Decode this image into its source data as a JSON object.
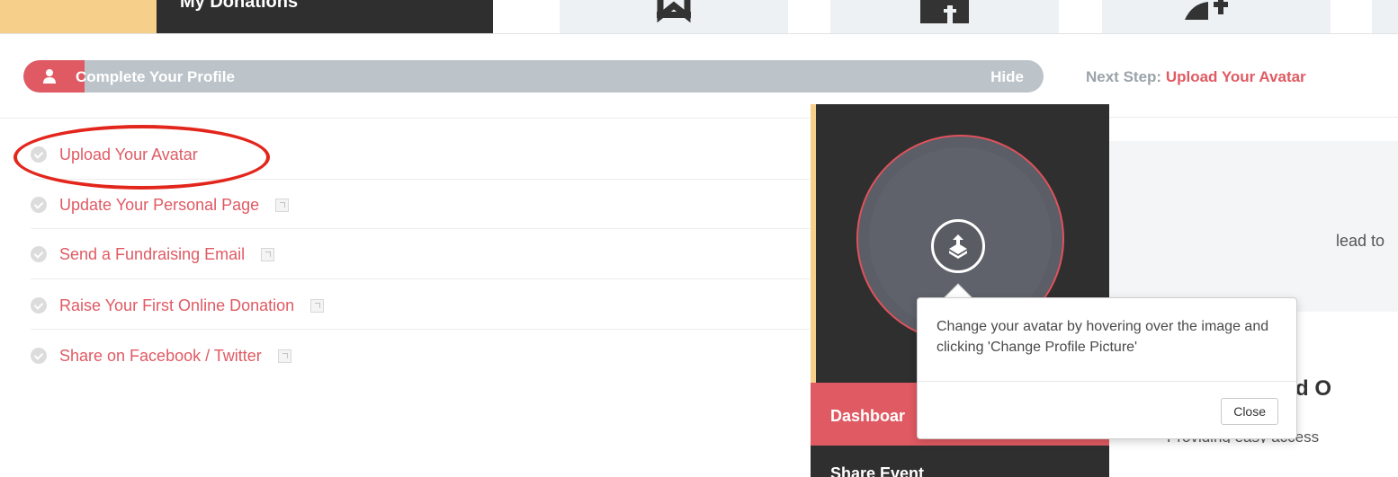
{
  "top_nav": {
    "my_donations_label": "My Donations"
  },
  "profile_progress": {
    "title": "Complete Your Profile",
    "hide_label": "Hide",
    "progress_fraction": 0.06,
    "next_step_label": "Next Step:",
    "next_step_link": "Upload Your Avatar"
  },
  "tasks": [
    {
      "label": "Upload Your Avatar",
      "external": false
    },
    {
      "label": "Update Your Personal Page",
      "external": true
    },
    {
      "label": "Send a Fundraising Email",
      "external": true
    },
    {
      "label": "Raise Your First Online Donation",
      "external": true
    },
    {
      "label": "Share on Facebook / Twitter",
      "external": true
    }
  ],
  "sidebar": {
    "menu": [
      {
        "label": "Dashboar",
        "active": true
      },
      {
        "label": "Share Event",
        "active": false
      }
    ]
  },
  "right_content": {
    "text_fragment": "lead to",
    "heading_fragment": "d O",
    "desc_fragment": "Providing easy access"
  },
  "popover": {
    "text": "Change your avatar by hovering over the image and clicking 'Change Profile Picture'",
    "close_label": "Close"
  },
  "colors": {
    "accent": "#e05a63",
    "dark_panel": "#2f2f2f",
    "sidebar_stripe": "#f6cf8a",
    "progress_track": "#bcc4ca",
    "highlight_ring": "#e3261c"
  },
  "icons": {
    "profile": "user-icon",
    "upload": "upload-icon",
    "task_check": "check-circle-icon",
    "task_external": "external-link-icon"
  }
}
